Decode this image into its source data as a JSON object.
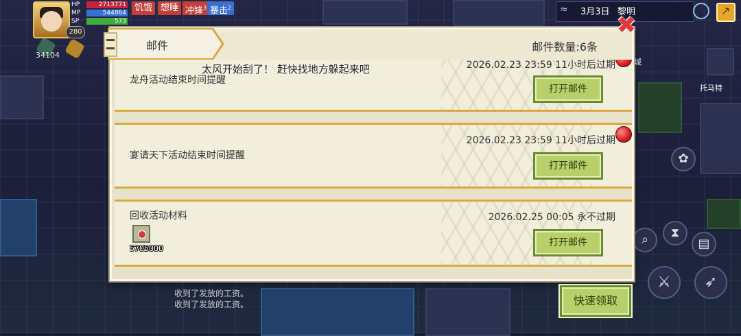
{
  "hud": {
    "hp_label": "HP",
    "hp_value": "2713771",
    "mp_label": "MP",
    "mp_value": "544864",
    "sp_label": "SP",
    "sp_value": "573",
    "level": "280",
    "gold": "34104",
    "status_tags": [
      {
        "label": "饥饿",
        "color": "#c2403a"
      },
      {
        "label": "想睡",
        "color": "#c2403a"
      },
      {
        "label": "冲锋",
        "sup": "3",
        "color": "#c2403a"
      },
      {
        "label": "暴击",
        "sup": "2",
        "color": "#3a6ed0"
      }
    ]
  },
  "topbar": {
    "date": "3月3日",
    "time_of_day": "黎明"
  },
  "world": {
    "npc_name": "托马特",
    "city_label": "城"
  },
  "chat": {
    "lines": [
      "收到了发放的工资。",
      "收到了发放的工资。"
    ]
  },
  "dialog": {
    "tab_title": "邮件",
    "mail_count": "邮件数量:6条",
    "broadcast": "太风开始刮了！ 赶快找地方躲起来吧",
    "mails": [
      {
        "title": "龙舟活动结束时间提醒",
        "time": "2026.02.23 23:59  11小时后过期",
        "button": "打开邮件",
        "unread": true
      },
      {
        "title": "宴请天下活动结束时间提醒",
        "time": "2026.02.23 23:59  11小时后过期",
        "button": "打开邮件",
        "unread": true
      },
      {
        "title": "回收活动材料",
        "time": "2026.02.25 00:05  永不过期",
        "button": "打开邮件",
        "unread": false,
        "item_qty": "5705000"
      }
    ],
    "quick_claim": "快速领取"
  },
  "colors": {
    "accent_gold": "#d8aa3c",
    "button_green": "#b8d06a",
    "close_red": "#e03a3a"
  }
}
